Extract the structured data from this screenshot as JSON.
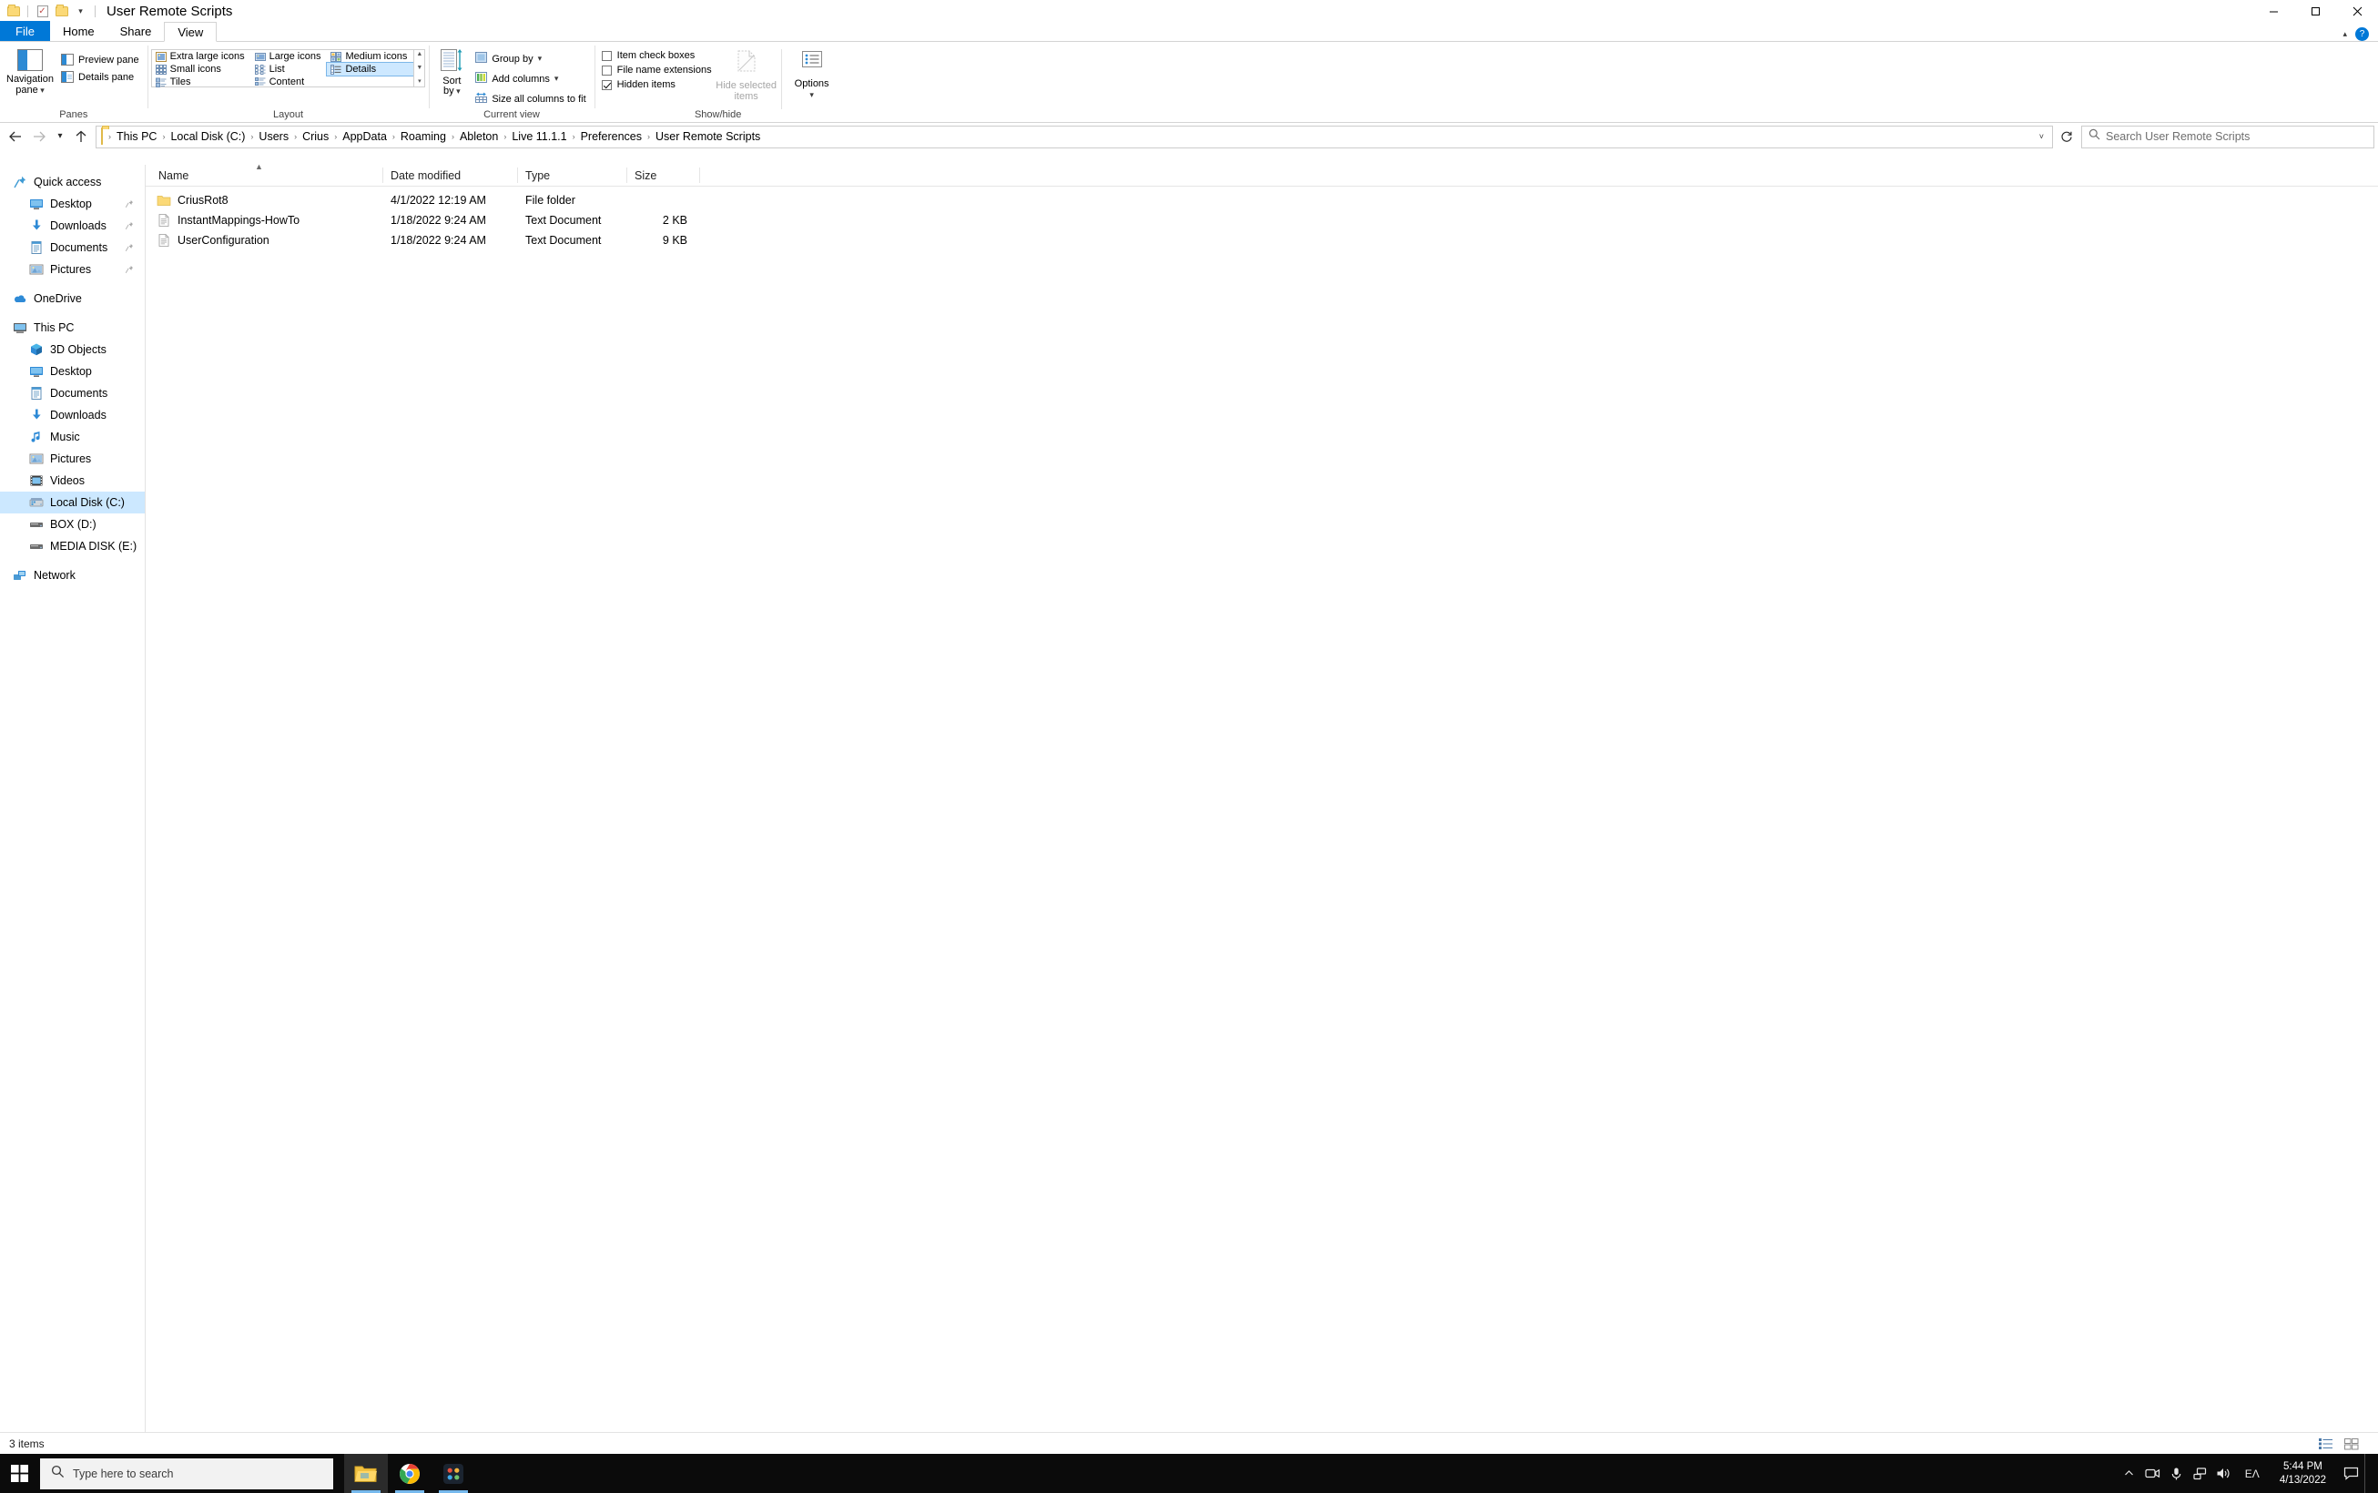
{
  "window": {
    "title": "User Remote Scripts",
    "quick_access_toolbar": [
      {
        "name": "folder-icon",
        "label": "Folder"
      },
      {
        "name": "properties-icon",
        "label": "Properties"
      },
      {
        "name": "new-folder-icon",
        "label": "New folder"
      },
      {
        "name": "customize-caret-icon",
        "label": "Customize Quick Access Toolbar"
      }
    ],
    "controls": {
      "minimize": "Minimize",
      "maximize": "Restore Down",
      "close": "Close"
    }
  },
  "ribbon": {
    "tabs": [
      {
        "label": "File",
        "active": false,
        "kind": "file"
      },
      {
        "label": "Home",
        "active": false
      },
      {
        "label": "Share",
        "active": false
      },
      {
        "label": "View",
        "active": true
      }
    ],
    "collapse_label": "Collapse the Ribbon",
    "help_label": "?",
    "groups": {
      "panes": {
        "label": "Panes",
        "navigation_pane": "Navigation\npane",
        "navigation_pane_line1": "Navigation",
        "navigation_pane_line2": "pane",
        "preview_pane": "Preview pane",
        "details_pane": "Details pane"
      },
      "layout": {
        "label": "Layout",
        "items": [
          {
            "label": "Extra large icons",
            "selected": false
          },
          {
            "label": "Small icons",
            "selected": false
          },
          {
            "label": "Tiles",
            "selected": false
          },
          {
            "label": "Large icons",
            "selected": false
          },
          {
            "label": "List",
            "selected": false
          },
          {
            "label": "Content",
            "selected": false
          },
          {
            "label": "Medium icons",
            "selected": false
          },
          {
            "label": "Details",
            "selected": true
          }
        ],
        "scroll_up": "▲",
        "scroll_down": "▼",
        "scroll_more": "▾"
      },
      "current_view": {
        "label": "Current view",
        "sort_by_line1": "Sort",
        "sort_by_line2": "by",
        "group_by": "Group by",
        "add_columns": "Add columns",
        "size_all_columns": "Size all columns to fit"
      },
      "show_hide": {
        "label": "Show/hide",
        "item_check_boxes": {
          "label": "Item check boxes",
          "checked": false
        },
        "file_name_extensions": {
          "label": "File name extensions",
          "checked": false
        },
        "hidden_items": {
          "label": "Hidden items",
          "checked": true
        },
        "hide_selected_line1": "Hide selected",
        "hide_selected_line2": "items",
        "hide_selected_disabled": true,
        "options": "Options"
      }
    }
  },
  "address_bar": {
    "back": "Back",
    "forward": "Forward",
    "recent": "Recent locations",
    "up": "Up",
    "breadcrumbs": [
      "This PC",
      "Local Disk (C:)",
      "Users",
      "Crius",
      "AppData",
      "Roaming",
      "Ableton",
      "Live 11.1.1",
      "Preferences",
      "User Remote Scripts"
    ],
    "separator": "›",
    "dropdown": "˅",
    "refresh": "Refresh"
  },
  "search": {
    "placeholder": "Search User Remote Scripts",
    "icon": "search-icon"
  },
  "sidebar": {
    "groups": [
      {
        "name": "quick-access",
        "header": {
          "label": "Quick access",
          "icon": "star-pin-icon"
        },
        "items": [
          {
            "label": "Desktop",
            "icon": "desktop-icon",
            "pinned": true
          },
          {
            "label": "Downloads",
            "icon": "downloads-icon",
            "pinned": true
          },
          {
            "label": "Documents",
            "icon": "documents-icon",
            "pinned": true
          },
          {
            "label": "Pictures",
            "icon": "pictures-icon",
            "pinned": true
          }
        ]
      },
      {
        "name": "onedrive",
        "header": {
          "label": "OneDrive",
          "icon": "onedrive-cloud-icon"
        },
        "items": []
      },
      {
        "name": "this-pc",
        "header": {
          "label": "This PC",
          "icon": "this-pc-icon"
        },
        "items": [
          {
            "label": "3D Objects",
            "icon": "3d-objects-icon",
            "pinned": false
          },
          {
            "label": "Desktop",
            "icon": "desktop-icon",
            "pinned": false
          },
          {
            "label": "Documents",
            "icon": "documents-icon",
            "pinned": false
          },
          {
            "label": "Downloads",
            "icon": "downloads-icon",
            "pinned": false
          },
          {
            "label": "Music",
            "icon": "music-icon",
            "pinned": false
          },
          {
            "label": "Pictures",
            "icon": "pictures-icon",
            "pinned": false
          },
          {
            "label": "Videos",
            "icon": "videos-icon",
            "pinned": false
          },
          {
            "label": "Local Disk (C:)",
            "icon": "hard-drive-icon",
            "pinned": false,
            "selected": true
          },
          {
            "label": "BOX (D:)",
            "icon": "removable-drive-icon",
            "pinned": false
          },
          {
            "label": "MEDIA DISK (E:)",
            "icon": "removable-drive-icon",
            "pinned": false
          }
        ]
      },
      {
        "name": "network",
        "header": {
          "label": "Network",
          "icon": "network-icon"
        },
        "items": []
      }
    ]
  },
  "file_list": {
    "columns": [
      {
        "key": "name",
        "label": "Name",
        "sorted": true,
        "sort_dir": "asc"
      },
      {
        "key": "date",
        "label": "Date modified"
      },
      {
        "key": "type",
        "label": "Type"
      },
      {
        "key": "size",
        "label": "Size"
      }
    ],
    "rows": [
      {
        "name": "CriusRot8",
        "date": "4/1/2022 12:19 AM",
        "type": "File folder",
        "size": "",
        "icon": "folder-icon"
      },
      {
        "name": "InstantMappings-HowTo",
        "date": "1/18/2022 9:24 AM",
        "type": "Text Document",
        "size": "2 KB",
        "icon": "text-document-icon"
      },
      {
        "name": "UserConfiguration",
        "date": "1/18/2022 9:24 AM",
        "type": "Text Document",
        "size": "9 KB",
        "icon": "text-document-icon"
      }
    ]
  },
  "status_bar": {
    "item_count": "3 items",
    "view_buttons": [
      {
        "name": "details-view-button",
        "label": "Details view",
        "active": true
      },
      {
        "name": "large-icons-view-button",
        "label": "Large icons view",
        "active": false
      }
    ]
  },
  "taskbar": {
    "start": "Start",
    "search_placeholder": "Type here to search",
    "apps": [
      {
        "name": "file-explorer-taskbar-icon",
        "label": "File Explorer",
        "running": true,
        "active": true
      },
      {
        "name": "chrome-taskbar-icon",
        "label": "Google Chrome",
        "running": true,
        "active": false
      },
      {
        "name": "davinci-resolve-taskbar-icon",
        "label": "DaVinci Resolve",
        "running": true,
        "active": false
      }
    ],
    "tray": [
      {
        "name": "show-hidden-icons-icon",
        "label": "Show hidden icons"
      },
      {
        "name": "camera-icon",
        "label": "Camera"
      },
      {
        "name": "microphone-icon",
        "label": "Microphone"
      },
      {
        "name": "network-tray-icon",
        "label": "Network"
      },
      {
        "name": "volume-icon",
        "label": "Speakers"
      }
    ],
    "language": "EΛ",
    "clock_time": "5:44 PM",
    "clock_date": "4/13/2022",
    "notifications": "Notifications"
  },
  "colors": {
    "accent": "#0078d7",
    "selection": "#cce8ff",
    "gallery_selection": "#cde8ff",
    "taskbar": "#0b0b0b",
    "folder_yellow": "#fbd977"
  }
}
